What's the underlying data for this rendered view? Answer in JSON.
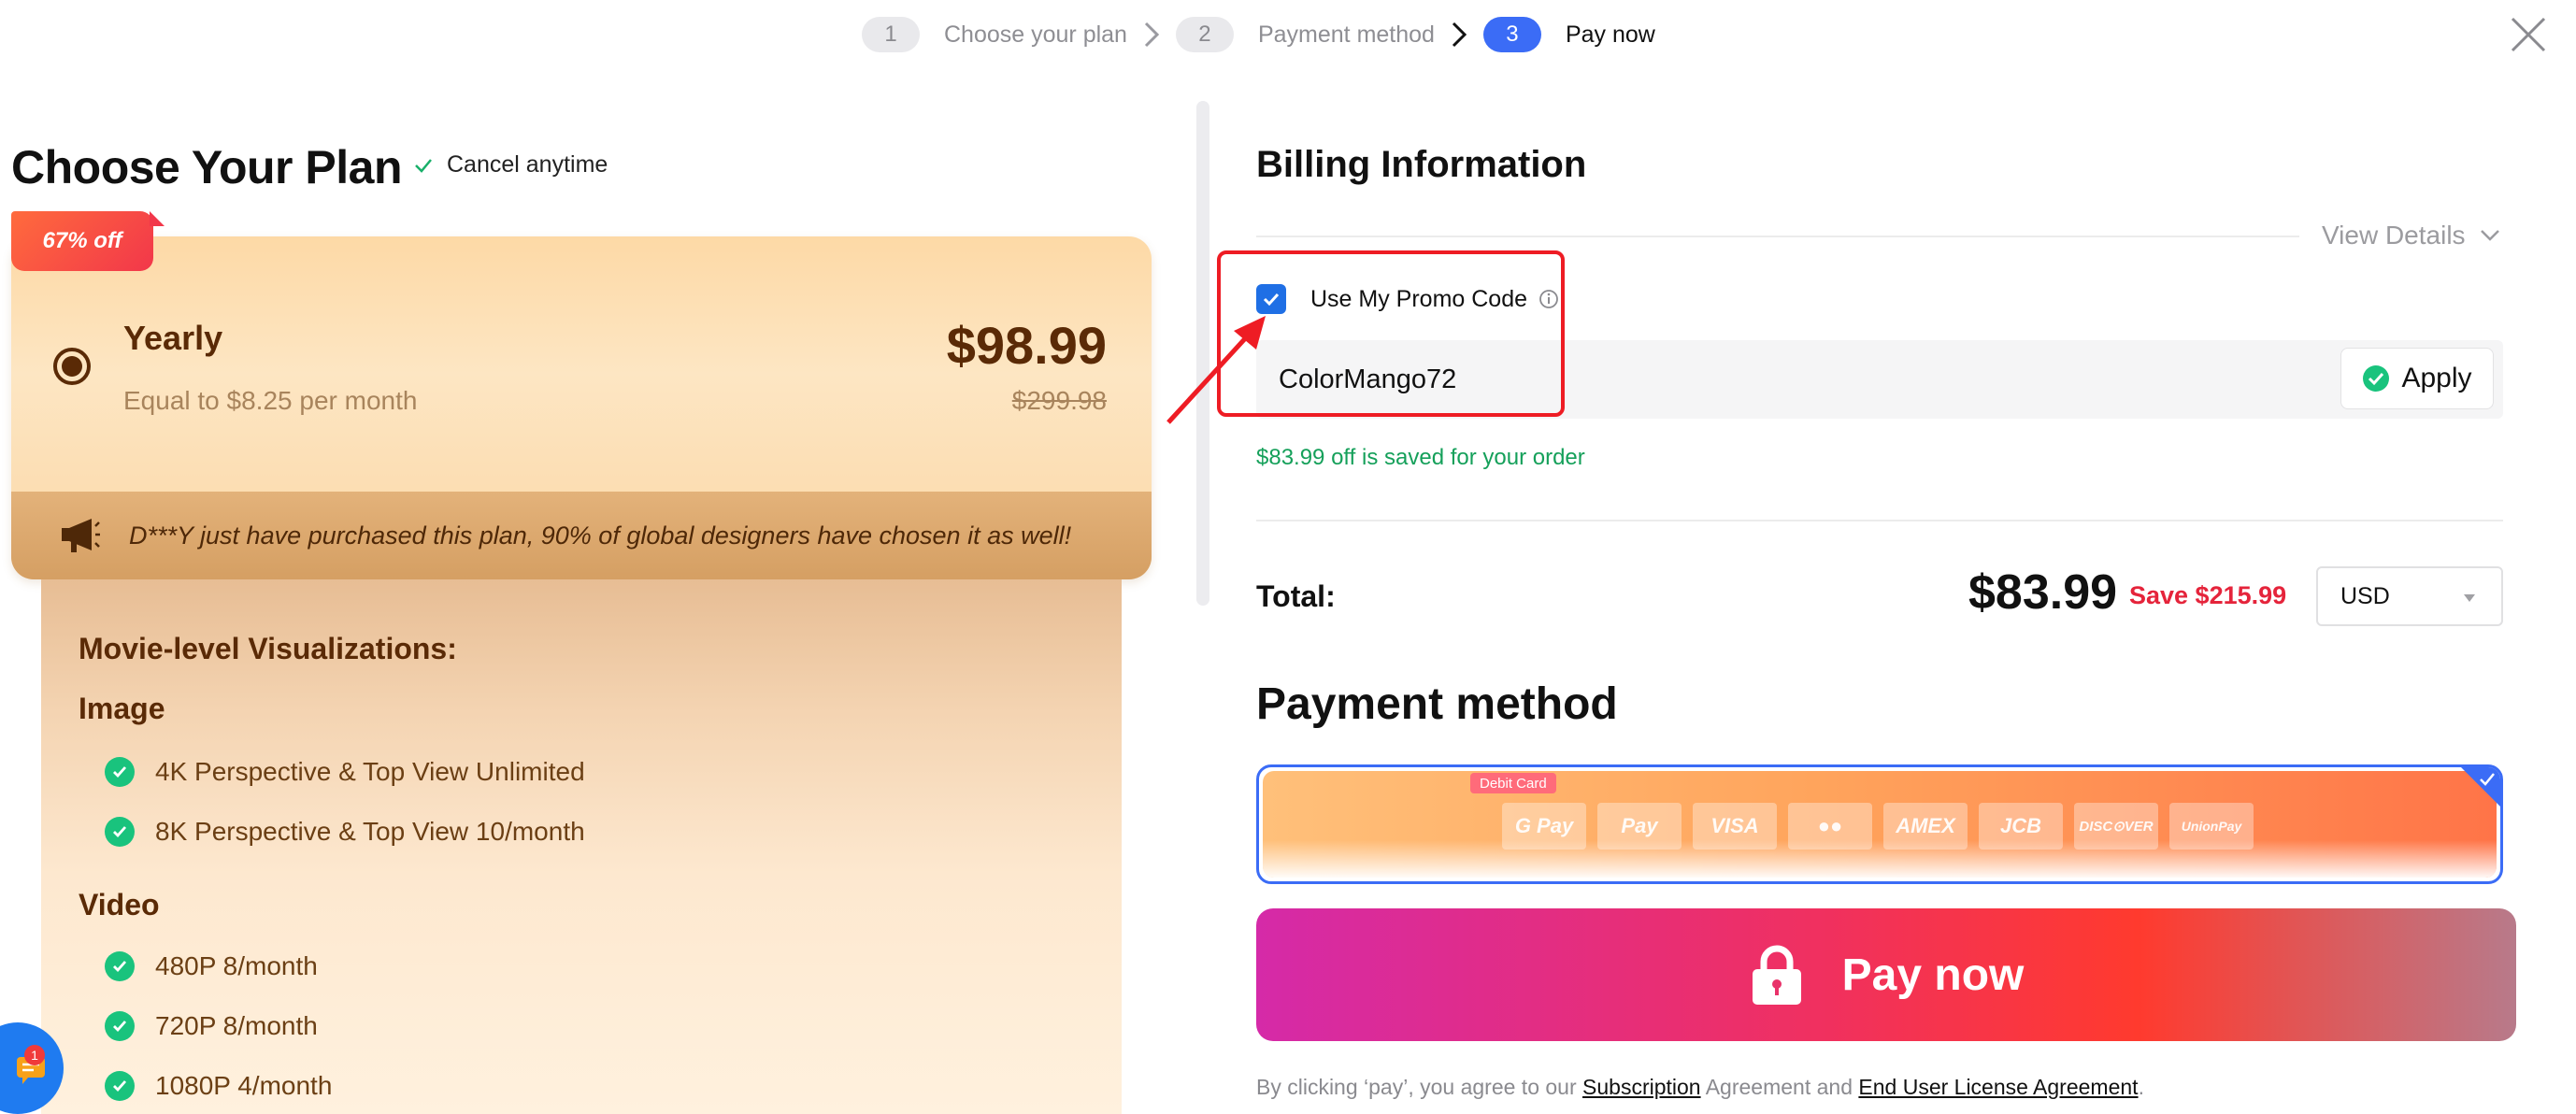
{
  "stepper": {
    "steps": [
      {
        "num": "1",
        "label": "Choose your plan"
      },
      {
        "num": "2",
        "label": "Payment method"
      },
      {
        "num": "3",
        "label": "Pay now"
      }
    ],
    "active_step": 3
  },
  "plan": {
    "heading": "Choose Your Plan",
    "cancel_text": "Cancel anytime",
    "discount_tag": "67% off",
    "name": "Yearly",
    "per_month": "Equal to $8.25 per month",
    "price": "$98.99",
    "old_price": "$299.98",
    "banner_text": "D***Y just have purchased this plan, 90% of global designers have chosen it as well!"
  },
  "features": {
    "heading": "Movie-level Visualizations:",
    "groups": [
      {
        "title": "Image",
        "items": [
          "4K Perspective & Top View Unlimited",
          "8K Perspective & Top View 10/month"
        ]
      },
      {
        "title": "Video",
        "items": [
          "480P 8/month",
          "720P 8/month",
          "1080P 4/month"
        ]
      }
    ]
  },
  "chat": {
    "badge": "1"
  },
  "billing": {
    "title": "Billing Information",
    "view_details": "View Details",
    "promo_label": "Use My Promo Code",
    "promo_checked": true,
    "promo_value": "ColorMango72",
    "apply_label": "Apply",
    "saved_msg": "$83.99 off is saved for your order",
    "total_label": "Total:",
    "total_amount": "$83.99",
    "total_save": "Save $215.99",
    "currency": "USD"
  },
  "payment": {
    "title": "Payment method",
    "debit_tag": "Debit Card",
    "logos": [
      "G Pay",
      " Pay",
      "VISA",
      "●●",
      "AMEX",
      "JCB",
      "DISC⊙VER",
      "UnionPay"
    ],
    "pay_label": "Pay now",
    "agree_prefix": "By clicking ‘pay’, you agree to our",
    "subscription_link": "Subscription",
    "agree_middle": "Agreement and",
    "eula_link": "End User License Agreement",
    "agree_suffix": "."
  },
  "colors": {
    "accent_blue": "#3b6cf6",
    "success_green": "#15a05a",
    "save_red": "#e5243b",
    "plan_brown": "#5a2a06",
    "highlight_red": "#ee1c24"
  }
}
